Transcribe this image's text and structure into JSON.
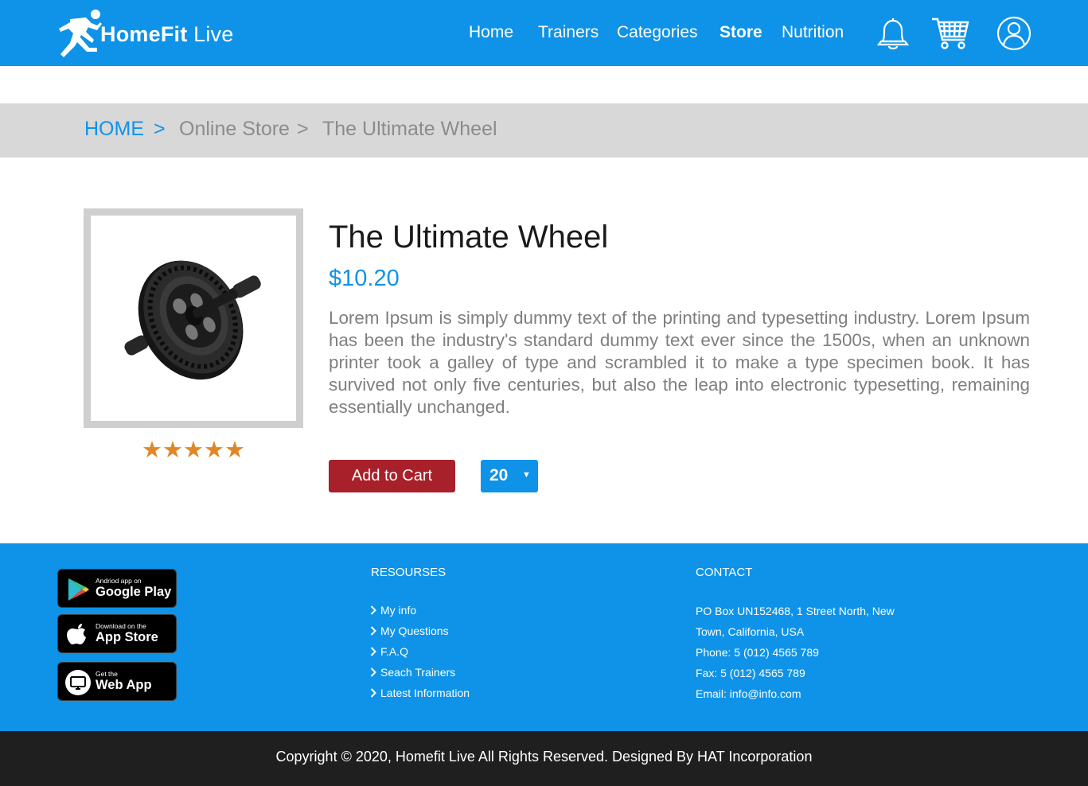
{
  "header": {
    "logo_bold": "HomeFit",
    "logo_light": "Live",
    "nav": [
      {
        "label": "Home"
      },
      {
        "label": "Trainers"
      },
      {
        "label": "Categories"
      },
      {
        "label": "Store"
      },
      {
        "label": "Nutrition"
      }
    ],
    "active_nav": "Store",
    "icons": [
      "bell-icon",
      "cart-icon",
      "user-icon"
    ]
  },
  "breadcrumb": {
    "home": "HOME",
    "sep": ">",
    "section": "Online Store",
    "current": "The Ultimate Wheel"
  },
  "product": {
    "title": "The Ultimate Wheel",
    "price": "$10.20",
    "description": "Lorem Ipsum is simply dummy text of the printing and typesetting industry. Lorem Ipsum has been the industry's standard dummy text ever since the 1500s, when an unknown printer took a galley of type and scrambled it to make a type specimen book. It has survived not only five centuries, but also the leap into electronic typesetting, remaining essentially unchanged.",
    "rating": 5,
    "rating_stars": "★★★★★",
    "add_to_cart_label": "Add to Cart",
    "quantity": "20",
    "quantity_caret": "▼"
  },
  "footer": {
    "badges": [
      {
        "small": "Andriod app on",
        "big": "Google Play",
        "icon": "google-play-icon"
      },
      {
        "small": "Download on the",
        "big": "App Store",
        "icon": "apple-icon"
      },
      {
        "small": "Get the",
        "big": "Web App",
        "icon": "monitor-icon"
      }
    ],
    "resources_heading": "RESOURSES",
    "resources": [
      {
        "label": "My info"
      },
      {
        "label": "My Questions"
      },
      {
        "label": "F.A.Q"
      },
      {
        "label": "Seach Trainers"
      },
      {
        "label": "Latest Information"
      }
    ],
    "contact_heading": "CONTACT",
    "contact_lines": [
      "PO Box UN152468, 1 Street North, New",
      "Town, California, USA",
      "Phone: 5 (012) 4565 789",
      "Fax: 5 (012) 4565 789",
      "Email: info@info.com"
    ],
    "copyright": "Copyright © 2020, Homefit Live All Rights Reserved. Designed By HAT Incorporation"
  },
  "colors": {
    "primary": "#0e93e8",
    "breadcrumb_bg": "#d8d8d8",
    "add_to_cart": "#a8202a",
    "star": "#e0872a",
    "copyright_bg": "#1f1f1f"
  }
}
